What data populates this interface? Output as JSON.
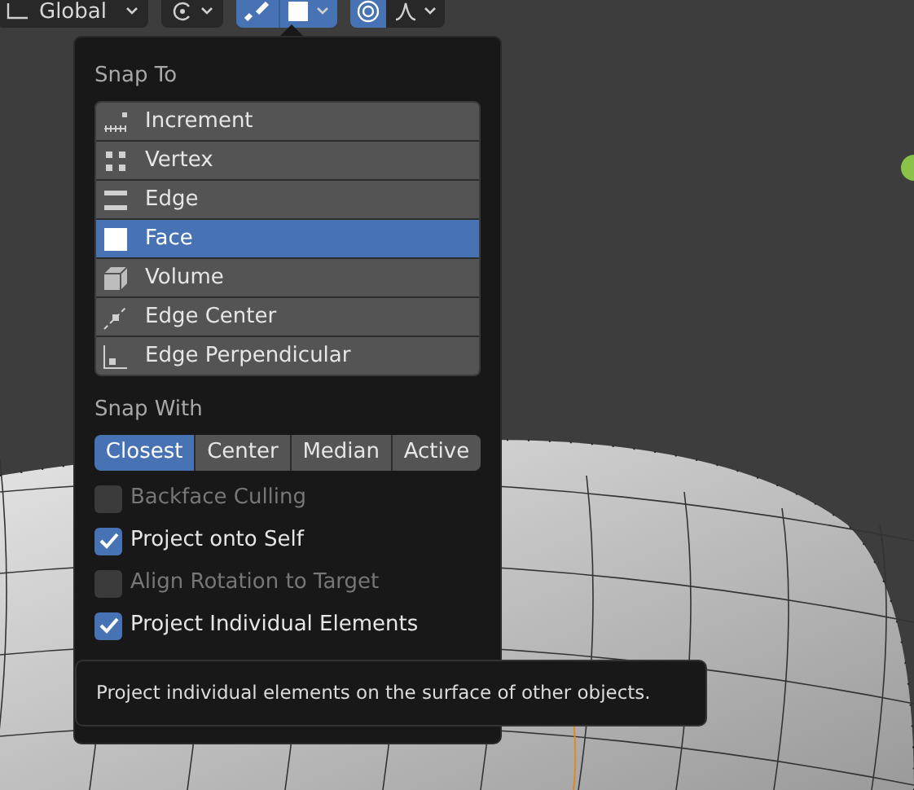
{
  "toolbar": {
    "orientation": "Global",
    "snap_on": true,
    "proportional_on": true
  },
  "snap_to": {
    "heading": "Snap To",
    "items": [
      {
        "label": "Increment",
        "kind": "increment",
        "selected": false
      },
      {
        "label": "Vertex",
        "kind": "vertex",
        "selected": false
      },
      {
        "label": "Edge",
        "kind": "edge",
        "selected": false
      },
      {
        "label": "Face",
        "kind": "face",
        "selected": true
      },
      {
        "label": "Volume",
        "kind": "volume",
        "selected": false
      },
      {
        "label": "Edge Center",
        "kind": "edge_center",
        "selected": false
      },
      {
        "label": "Edge Perpendicular",
        "kind": "edge_perpendicular",
        "selected": false
      }
    ]
  },
  "snap_with": {
    "heading": "Snap With",
    "options": [
      {
        "label": "Closest",
        "selected": true
      },
      {
        "label": "Center",
        "selected": false
      },
      {
        "label": "Median",
        "selected": false
      },
      {
        "label": "Active",
        "selected": false
      }
    ]
  },
  "options": [
    {
      "label": "Backface Culling",
      "checked": false,
      "disabled": true
    },
    {
      "label": "Project onto Self",
      "checked": true,
      "disabled": false
    },
    {
      "label": "Align Rotation to Target",
      "checked": false,
      "disabled": true
    },
    {
      "label": "Project Individual Elements",
      "checked": true,
      "disabled": false
    }
  ],
  "tooltip": {
    "text": "Project individual elements on the surface of other objects."
  }
}
